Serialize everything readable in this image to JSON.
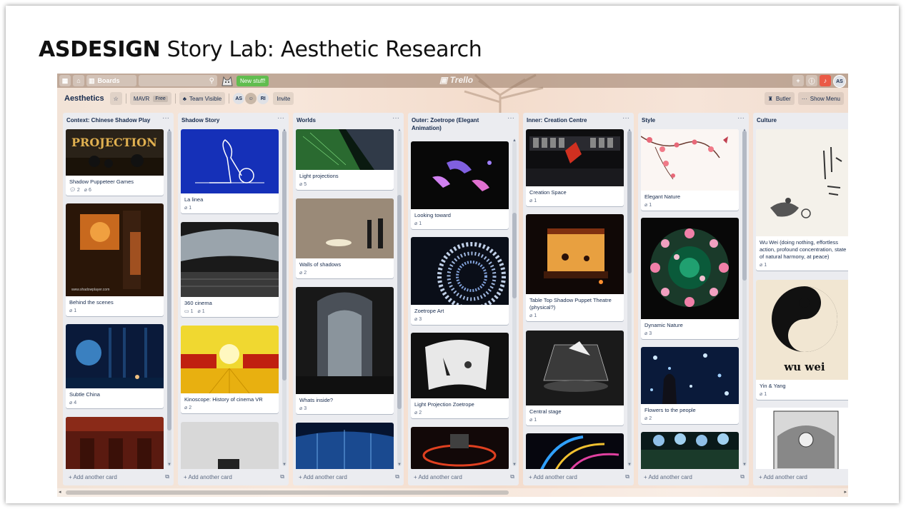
{
  "slide": {
    "title_bold": "ASDESIGN",
    "title_rest": " Story Lab: Aesthetic Research"
  },
  "topbar": {
    "boards_label": "Boards",
    "new_stuff_label": "New stuff!",
    "logo_text": "Trello",
    "user_initials": "AS"
  },
  "board": {
    "name": "Aesthetics",
    "team": "MAVR",
    "team_plan": "Free",
    "visibility": "Team Visible",
    "members": [
      "AS",
      "RI"
    ],
    "invite_label": "Invite",
    "butler_label": "Butler",
    "show_menu_label": "Show Menu"
  },
  "colors": {
    "new_stuff": "#61bd4f",
    "notification": "#eb5a46",
    "list_bg": "#ebecf0",
    "text": "#172b4d"
  },
  "add_card_label": "+ Add another card",
  "lists": [
    {
      "title": "Context: Chinese Shadow Play",
      "cards": [
        {
          "title": "Shadow Puppeteer Games",
          "comments": "2",
          "attachments": "6",
          "img_text": "PROJECTION"
        },
        {
          "title": "Behind the scenes",
          "attachments": "1",
          "img_text": "www.shadowplayer.com"
        },
        {
          "title": "Subtle China",
          "attachments": "4"
        },
        {
          "title": ""
        }
      ]
    },
    {
      "title": "Shadow Story",
      "cards": [
        {
          "title": "La linea",
          "attachments": "1"
        },
        {
          "title": "360 cinema",
          "comments": "1",
          "attachments": "1"
        },
        {
          "title": "Kinoscope: History of cinema VR",
          "attachments": "2"
        },
        {
          "title": ""
        }
      ]
    },
    {
      "title": "Worlds",
      "cards": [
        {
          "title": "Light projections",
          "attachments": "5"
        },
        {
          "title": "Walls of shadows",
          "attachments": "2"
        },
        {
          "title": "Whats inside?",
          "attachments": "3"
        },
        {
          "title": ""
        }
      ]
    },
    {
      "title": "Outer: Zoetrope (Elegant Animation)",
      "cards": [
        {
          "title": "Looking toward",
          "attachments": "1"
        },
        {
          "title": "Zoetrope Art",
          "attachments": "3"
        },
        {
          "title": "Light Projection Zoetrope",
          "attachments": "2"
        },
        {
          "title": ""
        }
      ]
    },
    {
      "title": "Inner: Creation Centre",
      "cards": [
        {
          "title": "Creation Space",
          "attachments": "1"
        },
        {
          "title": "Table Top Shadow Puppet Theatre (physical?)",
          "attachments": "1"
        },
        {
          "title": "Central stage",
          "attachments": "1"
        },
        {
          "title": ""
        }
      ]
    },
    {
      "title": "Style",
      "cards": [
        {
          "title": "Elegant Nature",
          "attachments": "1"
        },
        {
          "title": "Dynamic Nature",
          "attachments": "3"
        },
        {
          "title": "Flowers to the people",
          "attachments": "2"
        },
        {
          "title": ""
        }
      ]
    },
    {
      "title": "Culture",
      "cards": [
        {
          "title": "Wu Wei (doing nothing, effortless action, profound concentration, state of natural harmony, at peace)",
          "attachments": "1"
        },
        {
          "title": "Yin & Yang",
          "attachments": "1",
          "img_text": "wu wei"
        },
        {
          "title": ""
        }
      ]
    }
  ]
}
